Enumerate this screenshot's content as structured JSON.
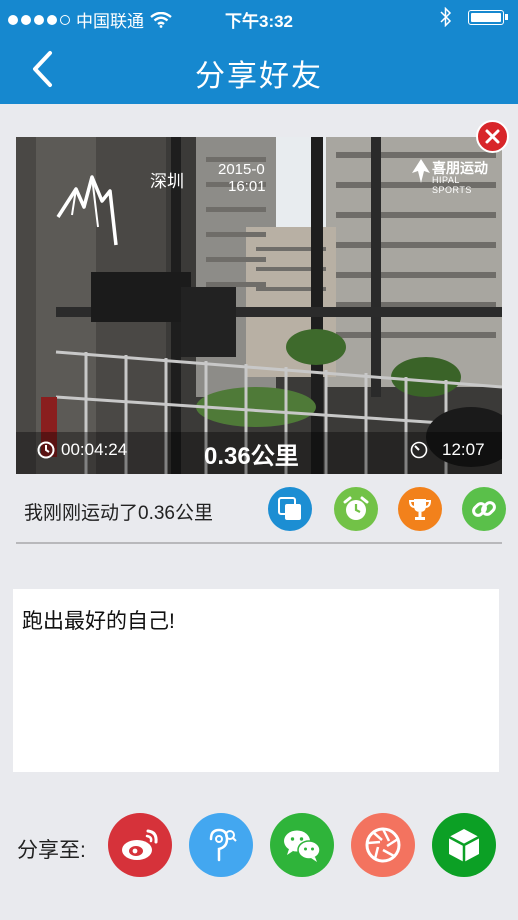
{
  "status_bar": {
    "carrier": "中国联通",
    "time": "下午3:32"
  },
  "navbar": {
    "title": "分享好友"
  },
  "photo": {
    "city": "深圳",
    "date": "2015-0",
    "clock": "16:01",
    "brand": "喜朋运动",
    "brand_sub": "HIPAL SPORTS",
    "duration": "00:04:24",
    "distance": "0.36公里",
    "pace": "12:07"
  },
  "summary": {
    "text": "我刚刚运动了0.36公里"
  },
  "message": {
    "text": "跑出最好的自己!"
  },
  "share": {
    "label": "分享至:"
  },
  "colors": {
    "primary": "#1688cf",
    "weibo": "#d6323a",
    "qzone": "#43a7f0",
    "wechat": "#2fb43a",
    "moments": "#f3735f",
    "other": "#0ca025"
  }
}
